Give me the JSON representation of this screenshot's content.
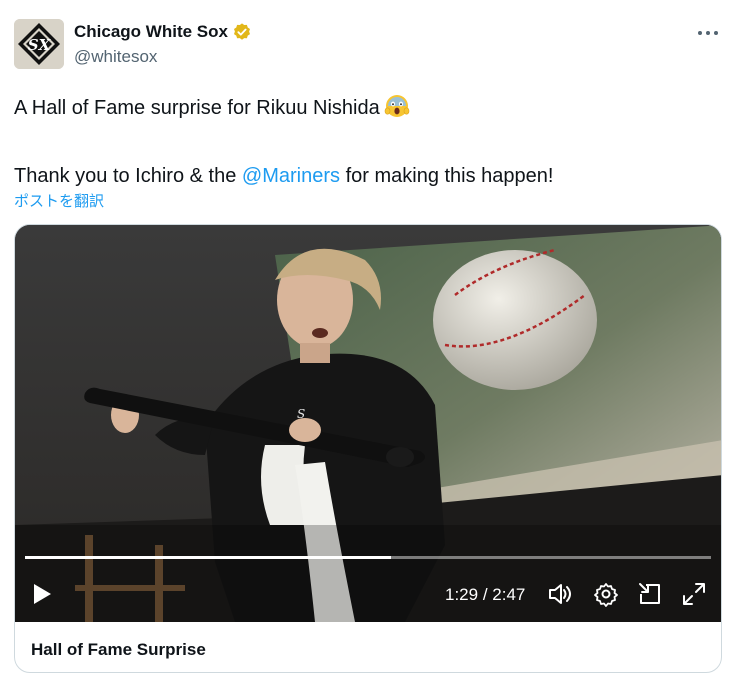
{
  "account": {
    "display_name": "Chicago White Sox",
    "handle": "@whitesox",
    "avatar_icon": "white-sox-logo-icon",
    "verified_icon": "verified-badge-icon",
    "verified_color": "#e2b719"
  },
  "tweet": {
    "line1": "A Hall of Fame surprise for Rikuu Nishida",
    "line1_emoji": "screaming-face-emoji",
    "line2_pre": "Thank you to Ichiro & the ",
    "line2_mention": "@Mariners",
    "line2_post": " for making this happen!",
    "translate_label": "ポストを翻訳"
  },
  "video": {
    "current_time": "1:29",
    "separator": " / ",
    "duration": "2:47",
    "progress_fraction": 0.533,
    "title": "Hall of Fame Surprise"
  },
  "colors": {
    "link": "#1d9bf0",
    "text": "#0f1419",
    "secondary": "#536471"
  }
}
